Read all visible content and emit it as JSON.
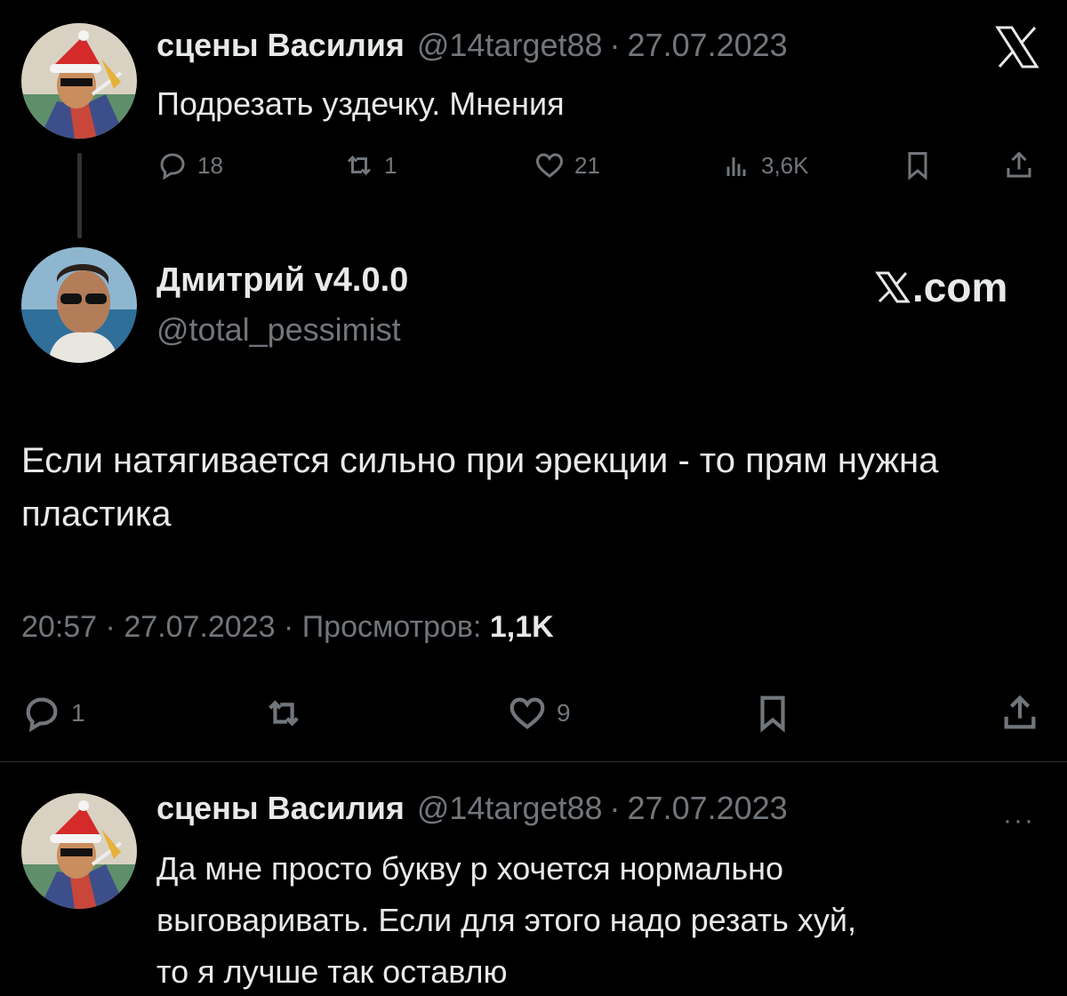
{
  "parent_tweet": {
    "name": "сцены Василия",
    "handle": "@14target88",
    "date": "27.07.2023",
    "text": "Подрезать уздечку. Мнения",
    "replies": "18",
    "retweets": "1",
    "likes": "21",
    "views": "3,6K",
    "avatar_icon": "santa-hat-avatar"
  },
  "brand_logo": "x-logo-icon",
  "main_tweet": {
    "name": "Дмитрий v4.0.0",
    "handle": "@total_pessimist",
    "watermark": ".com",
    "text": "Если натягивается сильно при эрекции - то прям нужна пластика",
    "time": "20:57",
    "date": "27.07.2023",
    "views_label": "Просмотров:",
    "views": "1,1K",
    "replies": "1",
    "likes": "9"
  },
  "reply_tweet": {
    "name": "сцены Василия",
    "handle": "@14target88",
    "date": "27.07.2023",
    "text_line1": "Да мне просто букву р хочется нормально",
    "text_line2": "выговаривать. Если для этого надо резать хуй,",
    "text_line3": "то я лучше так оставлю",
    "more": "···"
  },
  "colors": {
    "background": "#000000",
    "text": "#e7e9ea",
    "muted": "#71767b",
    "divider": "#2f3336"
  }
}
